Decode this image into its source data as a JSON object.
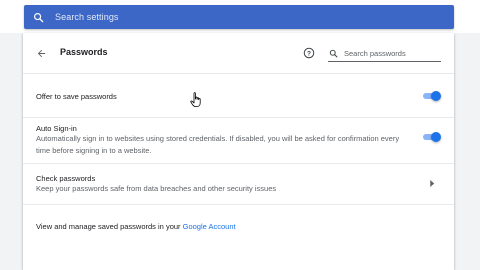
{
  "search": {
    "placeholder": "Search settings",
    "icon": "search-icon"
  },
  "header": {
    "title": "Passwords",
    "back_icon": "back-arrow-icon",
    "help_icon": "help-icon",
    "search_placeholder": "Search passwords"
  },
  "settings": {
    "offer_to_save": {
      "label": "Offer to save passwords",
      "enabled": true
    },
    "auto_sign_in": {
      "label": "Auto Sign-in",
      "description": "Automatically sign in to websites using stored credentials. If disabled, you will be asked for confirmation every time before signing in to a website.",
      "enabled": true
    },
    "check_passwords": {
      "label": "Check passwords",
      "description": "Keep your passwords safe from data breaches and other security issues",
      "icon": "chevron-right-icon"
    },
    "manage": {
      "text": "View and manage saved passwords in your ",
      "link_label": "Google Account"
    }
  },
  "colors": {
    "searchbar": "#3c67c6",
    "accent": "#1a73e8",
    "toggle_track": "#8ab4f8",
    "background": "#f1f3f4"
  }
}
